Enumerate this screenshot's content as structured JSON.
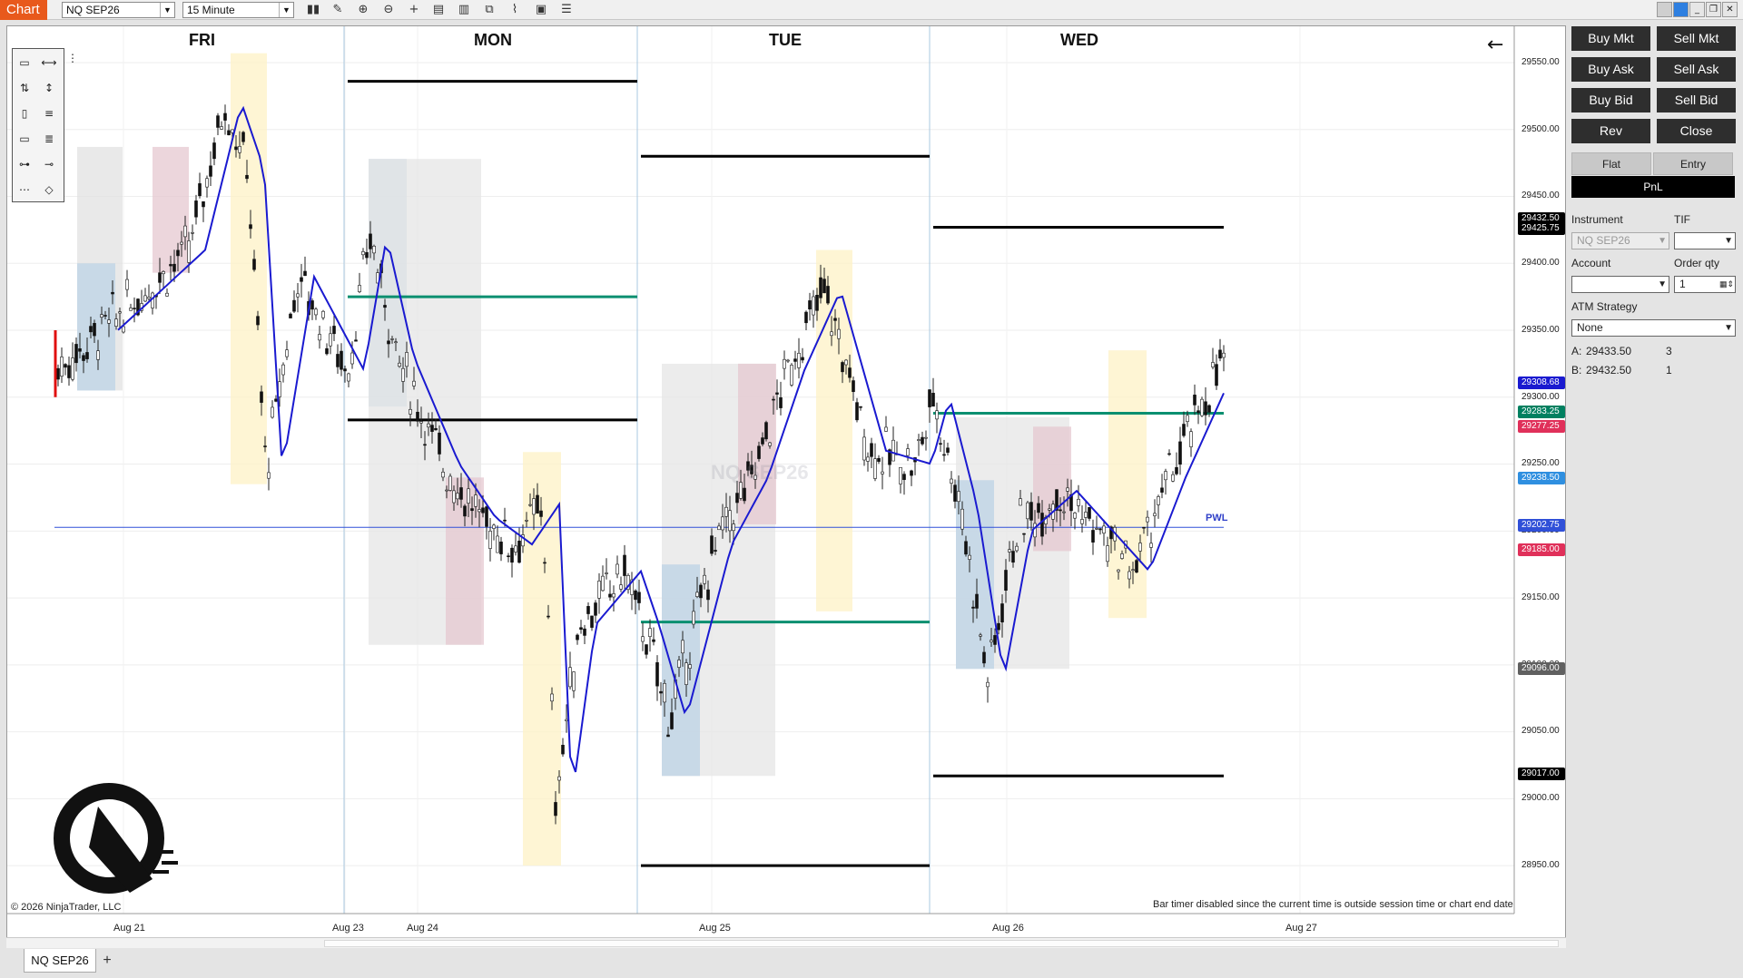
{
  "toolbar": {
    "chart_tab": "Chart",
    "instrument": "NQ SEP26",
    "interval": "15 Minute",
    "icons": [
      "bar-type-icon",
      "draw-pencil-icon",
      "zoom-in-icon",
      "zoom-out-icon",
      "crosshair-icon",
      "data-box-icon",
      "templates-icon",
      "strategies-icon",
      "indicators-icon",
      "properties-icon",
      "object-list-icon"
    ]
  },
  "window_controls": [
    "min-grey",
    "blue",
    "minimize",
    "restore",
    "close"
  ],
  "chart": {
    "days": [
      "FRI",
      "MON",
      "TUE",
      "WED"
    ],
    "dates": [
      "Aug 21",
      "Aug 23",
      "Aug 24",
      "Aug 25",
      "Aug 26",
      "Aug 27"
    ],
    "price_ticks": [
      "29550.00",
      "29500.00",
      "29450.00",
      "29400.00",
      "29350.00",
      "29300.00",
      "29250.00",
      "29200.00",
      "29150.00",
      "29100.00",
      "29050.00",
      "29000.00",
      "28950.00"
    ],
    "badges": [
      {
        "label": "29432.50",
        "color": "#000000"
      },
      {
        "label": "29425.75",
        "color": "#000000"
      },
      {
        "label": "29308.68",
        "color": "#1a1ad0"
      },
      {
        "label": "29283.25",
        "color": "#008060"
      },
      {
        "label": "29277.25",
        "color": "#e0305a"
      },
      {
        "label": "29238.50",
        "color": "#2f8fe0"
      },
      {
        "label": "29202.75",
        "color": "#3050d8"
      },
      {
        "label": "29185.00",
        "color": "#e0305a"
      },
      {
        "label": "29096.00",
        "color": "#606060"
      },
      {
        "label": "29017.00",
        "color": "#000000"
      }
    ],
    "pwl_label": "PWL",
    "watermark": "NQ SEP26",
    "copyright": "© 2026 NinjaTrader, LLC",
    "bar_timer": "Bar timer disabled since the current time is outside session time or chart end date",
    "back_arrow": "←"
  },
  "bottom": {
    "tab_label": "NQ SEP26",
    "add_tab": "+"
  },
  "order_panel": {
    "buttons": [
      "Buy Mkt",
      "Sell Mkt",
      "Buy Ask",
      "Sell Ask",
      "Buy Bid",
      "Sell Bid",
      "Rev",
      "Close"
    ],
    "flat": "Flat",
    "entry": "Entry",
    "pnl": "PnL",
    "instrument_label": "Instrument",
    "instrument_value": "NQ SEP26",
    "tif_label": "TIF",
    "tif_value": "",
    "account_label": "Account",
    "account_value": "",
    "order_qty_label": "Order qty",
    "order_qty_value": "1",
    "atm_label": "ATM Strategy",
    "atm_value": "None",
    "ask_label": "A:",
    "ask_price": "29433.50",
    "ask_size": "3",
    "bid_label": "B:",
    "bid_price": "29432.50",
    "bid_size": "1"
  }
}
